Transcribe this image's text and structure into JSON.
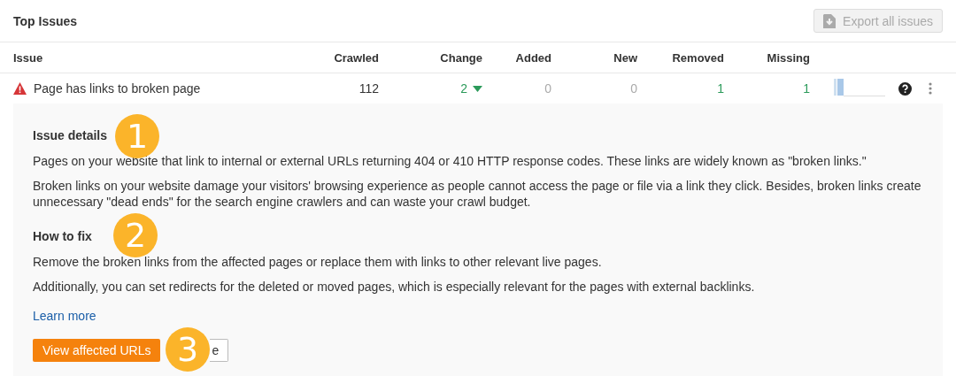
{
  "header": {
    "title": "Top Issues",
    "export_button": {
      "label": "Export all issues",
      "disabled": true
    }
  },
  "table": {
    "columns": [
      "Issue",
      "Crawled",
      "Change",
      "Added",
      "New",
      "Removed",
      "Missing"
    ],
    "rows": [
      {
        "issue": "Page has links to broken page",
        "warning": true,
        "crawled": "112",
        "change": {
          "value": "2",
          "decreased": true
        },
        "counts": [
          {
            "value": "0",
            "kind": "zero"
          },
          {
            "value": "0",
            "kind": "zero"
          },
          {
            "value": "1",
            "kind": "positive"
          },
          {
            "value": "1",
            "kind": "positive"
          }
        ],
        "expanded": true
      }
    ]
  },
  "details": {
    "sections": [
      {
        "heading": "Issue details",
        "paragraphs": [
          "Pages on your website that link to internal or external URLs returning 404 or 410 HTTP response codes. These links are widely known as \"broken links.\"",
          "Broken links on your website damage your visitors' browsing experience as people cannot access the page or file via a link they click. Besides, broken links create unnecessary \"dead ends\" for the search engine crawlers and can waste your crawl budget."
        ]
      },
      {
        "heading": "How to fix",
        "paragraphs": [
          "Remove the broken links from the affected pages or replace them with links to other relevant live pages.",
          "Additionally, you can set redirects for the deleted or moved pages, which is especially relevant for the pages with external backlinks."
        ]
      }
    ],
    "link": "Learn more",
    "primary_button": "View affected URLs",
    "secondary_button": "e"
  },
  "callouts": [
    "1",
    "2",
    "3"
  ]
}
